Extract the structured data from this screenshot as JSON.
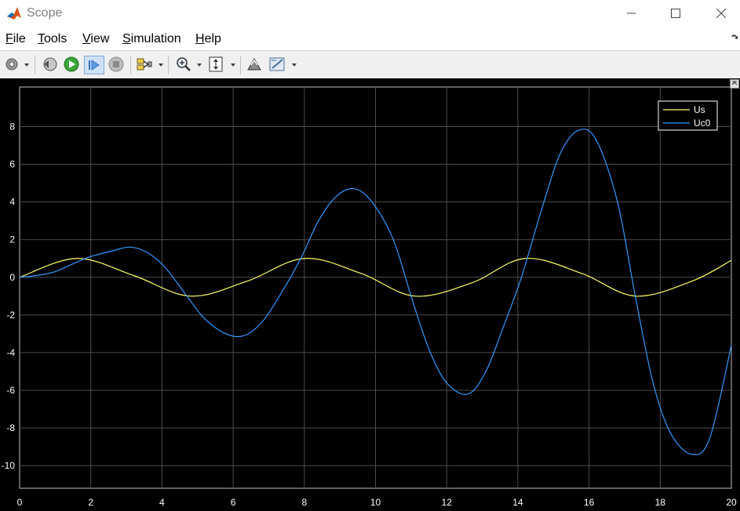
{
  "window": {
    "title": "Scope",
    "logo_icon": "matlab-logo-icon"
  },
  "menu": {
    "items": [
      {
        "label_mn": "F",
        "label_rest": "ile"
      },
      {
        "label_mn": "T",
        "label_rest": "ools"
      },
      {
        "label_mn": "V",
        "label_rest": "iew"
      },
      {
        "label_mn": "S",
        "label_rest": "imulation"
      },
      {
        "label_mn": "H",
        "label_rest": "elp"
      }
    ]
  },
  "toolbar": {
    "buttons": [
      "settings-icon",
      "step-back-icon",
      "run-icon",
      "step-forward-icon",
      "stop-icon",
      "signal-select-icon",
      "zoom-icon",
      "scale-axes-icon",
      "restore-layout-icon",
      "measure-icon"
    ]
  },
  "colors": {
    "background": "#000000",
    "grid": "#4d4d4d",
    "axis": "#ffffff",
    "us": "#ffff66",
    "uc0": "#3399ff"
  },
  "chart_data": {
    "type": "line",
    "title": "",
    "xlabel": "",
    "ylabel": "",
    "xlim": [
      0,
      20
    ],
    "ylim": [
      -11.2,
      10.1
    ],
    "xticks": [
      0,
      2,
      4,
      6,
      8,
      10,
      12,
      14,
      16,
      18,
      20
    ],
    "yticks": [
      -10,
      -8,
      -6,
      -4,
      -2,
      0,
      2,
      4,
      6,
      8
    ],
    "grid": true,
    "legend_position": "top-right",
    "series": [
      {
        "name": "Us",
        "color": "#ffff66",
        "x": [
          0,
          1.6,
          3.2,
          4.8,
          6.4,
          8.0,
          9.6,
          11.1,
          12.7,
          14.2,
          15.8,
          17.3,
          18.9,
          20
        ],
        "y": [
          0,
          1.0,
          0.1,
          -1.0,
          -0.2,
          1.0,
          0.2,
          -1.0,
          -0.3,
          1.0,
          0.2,
          -1.0,
          -0.2,
          0.9
        ]
      },
      {
        "name": "Uc0",
        "color": "#3399ff",
        "x": [
          0,
          0.5,
          1.0,
          1.6,
          2.0,
          2.6,
          3.1,
          3.6,
          4.1,
          4.7,
          5.2,
          5.8,
          6.3,
          6.8,
          7.3,
          7.9,
          8.4,
          8.9,
          9.4,
          9.9,
          10.5,
          11.0,
          11.5,
          12.0,
          12.6,
          13.1,
          13.6,
          14.1,
          14.7,
          15.2,
          15.7,
          16.2,
          16.8,
          17.3,
          17.8,
          18.3,
          18.9,
          19.4,
          20.0
        ],
        "y": [
          0,
          0.1,
          0.3,
          0.8,
          1.1,
          1.4,
          1.6,
          1.3,
          0.5,
          -1.0,
          -2.2,
          -3.0,
          -3.1,
          -2.4,
          -1.0,
          1.0,
          3.0,
          4.3,
          4.7,
          4.0,
          2.0,
          -1.0,
          -3.8,
          -5.6,
          -6.2,
          -5.0,
          -2.6,
          0.0,
          3.8,
          6.6,
          7.8,
          7.3,
          4.0,
          -1.0,
          -5.6,
          -8.3,
          -9.4,
          -8.5,
          -3.6
        ]
      }
    ]
  }
}
